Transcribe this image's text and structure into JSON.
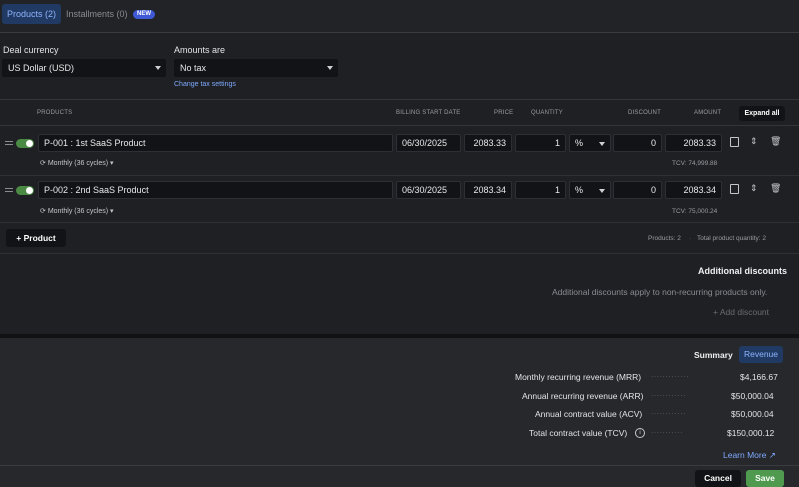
{
  "tabs": {
    "products": "Products (2)",
    "installments": "Installments (0)",
    "badge": "NEW"
  },
  "deal_currency": {
    "label": "Deal currency",
    "value": "US Dollar (USD)"
  },
  "amounts": {
    "label": "Amounts are",
    "value": "No tax",
    "link": "Change tax settings"
  },
  "table": {
    "headers": {
      "products": "PRODUCTS",
      "billing": "BILLING START DATE",
      "price": "PRICE",
      "quantity": "QUANTITY",
      "discount": "DISCOUNT",
      "amount": "AMOUNT"
    },
    "expand_all": "Expand all"
  },
  "rows": [
    {
      "name": "P-001 : 1st SaaS Product",
      "date": "06/30/2025",
      "price": "2083.33",
      "qty": "1",
      "disc_type": "%",
      "disc": "0",
      "amount": "2083.33",
      "freq": "Monthly (36 cycles)",
      "tcv": "TCV: 74,999.88"
    },
    {
      "name": "P-002 : 2nd SaaS Product",
      "date": "06/30/2025",
      "price": "2083.34",
      "qty": "1",
      "disc_type": "%",
      "disc": "0",
      "amount": "2083.34",
      "freq": "Monthly (36 cycles)",
      "tcv": "TCV: 75,000.24"
    }
  ],
  "footer": {
    "add_product": "Product",
    "products_count": "Products: 2",
    "total_qty": "Total product quantity: 2"
  },
  "additional": {
    "title": "Additional discounts",
    "note": "Additional discounts apply to non-recurring products only.",
    "add": "Add discount"
  },
  "summary": {
    "label": "Summary",
    "revenue_tab": "Revenue",
    "rows": [
      {
        "label": "Monthly recurring revenue (MRR)",
        "value": "$4,166.67"
      },
      {
        "label": "Annual recurring revenue (ARR)",
        "value": "$50,000.04"
      },
      {
        "label": "Annual contract value (ACV)",
        "value": "$50,000.04"
      },
      {
        "label": "Total contract value (TCV)",
        "value": "$150,000.12"
      }
    ],
    "learn_more": "Learn More"
  },
  "actions": {
    "cancel": "Cancel",
    "save": "Save"
  },
  "colors": {
    "accent": "#8fb4ff",
    "save": "#4f9a4f",
    "toggle": "#4a8a44"
  }
}
